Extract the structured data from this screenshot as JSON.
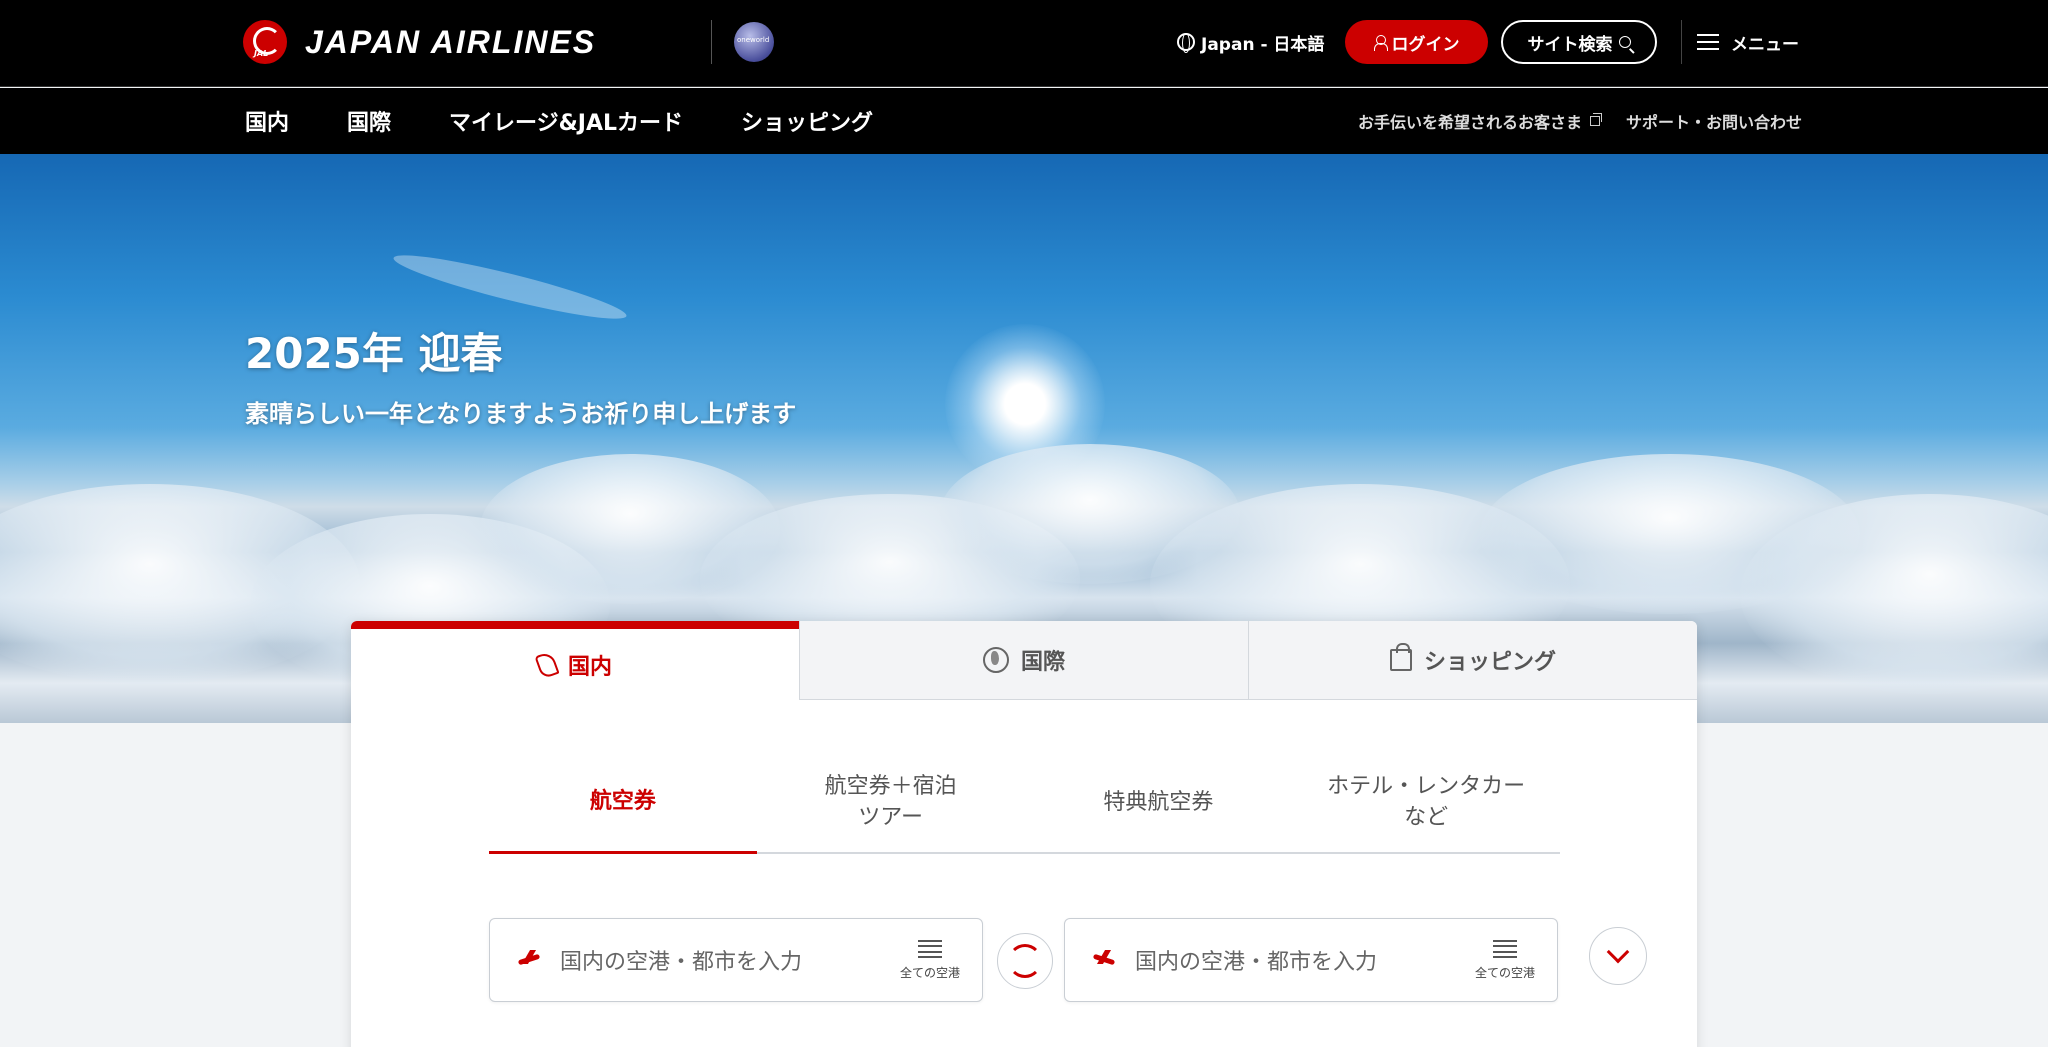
{
  "header": {
    "brand": "JAPAN AIRLINES",
    "crane_text": "JAL",
    "oneworld_text": "oneworld",
    "language": "Japan - 日本語",
    "login_label": "ログイン",
    "search_label": "サイト検索",
    "menu_label": "メニュー"
  },
  "nav": {
    "main": [
      "国内",
      "国際",
      "マイレージ&JALカード",
      "ショッピング"
    ],
    "sub": [
      "お手伝いを希望されるお客さま",
      "サポート・お問い合わせ"
    ]
  },
  "hero": {
    "title": "2025年 迎春",
    "subtitle": "素晴らしい一年となりますようお祈り申し上げます"
  },
  "booking": {
    "tabs": [
      "国内",
      "国際",
      "ショッピング"
    ],
    "subtabs": [
      "航空券",
      "航空券＋宿泊\nツアー",
      "特典航空券",
      "ホテル・レンタカー\nなど"
    ],
    "from_placeholder": "国内の空港・都市を入力",
    "to_placeholder": "国内の空港・都市を入力",
    "all_airports": "全ての空港"
  }
}
